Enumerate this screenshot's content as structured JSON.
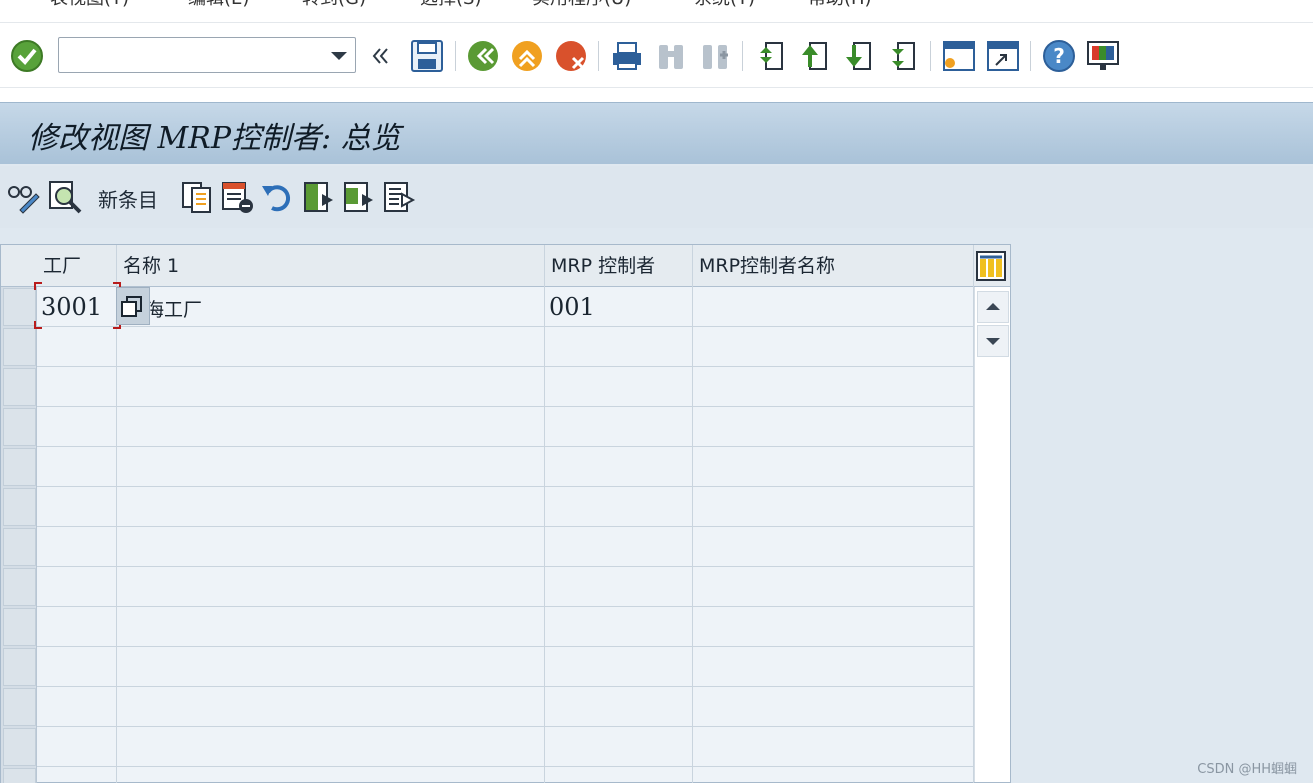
{
  "menu": {
    "items": [
      "表视图(T)",
      "编辑(E)",
      "转到(G)",
      "选择(S)",
      "实用程序(U)",
      "系统(Y)",
      "帮助(H)"
    ]
  },
  "toolbar": {
    "command_value": "",
    "icons": [
      "ok-check",
      "back-arrows",
      "save",
      "back",
      "exit",
      "cancel",
      "print",
      "find",
      "find-next",
      "first-page",
      "prev-page",
      "next-page",
      "last-page",
      "new-session",
      "shortcut",
      "help",
      "layout"
    ]
  },
  "title": "修改视图 MRP控制者: 总览",
  "app_toolbar": {
    "new_entries_label": "新条目"
  },
  "table": {
    "columns": [
      "工厂",
      "名称 1",
      "MRP 控制者",
      "MRP控制者名称"
    ],
    "rows": [
      {
        "plant": "3001",
        "name": "海工厂",
        "controller": "001",
        "controller_name": ""
      }
    ],
    "empty_rows": 12
  },
  "watermark": "CSDN @HH蝈蝈",
  "colors": {
    "title_bg": "#a9c2d8",
    "app_bg": "#dde6ee",
    "cursor": "#b81c1c"
  }
}
